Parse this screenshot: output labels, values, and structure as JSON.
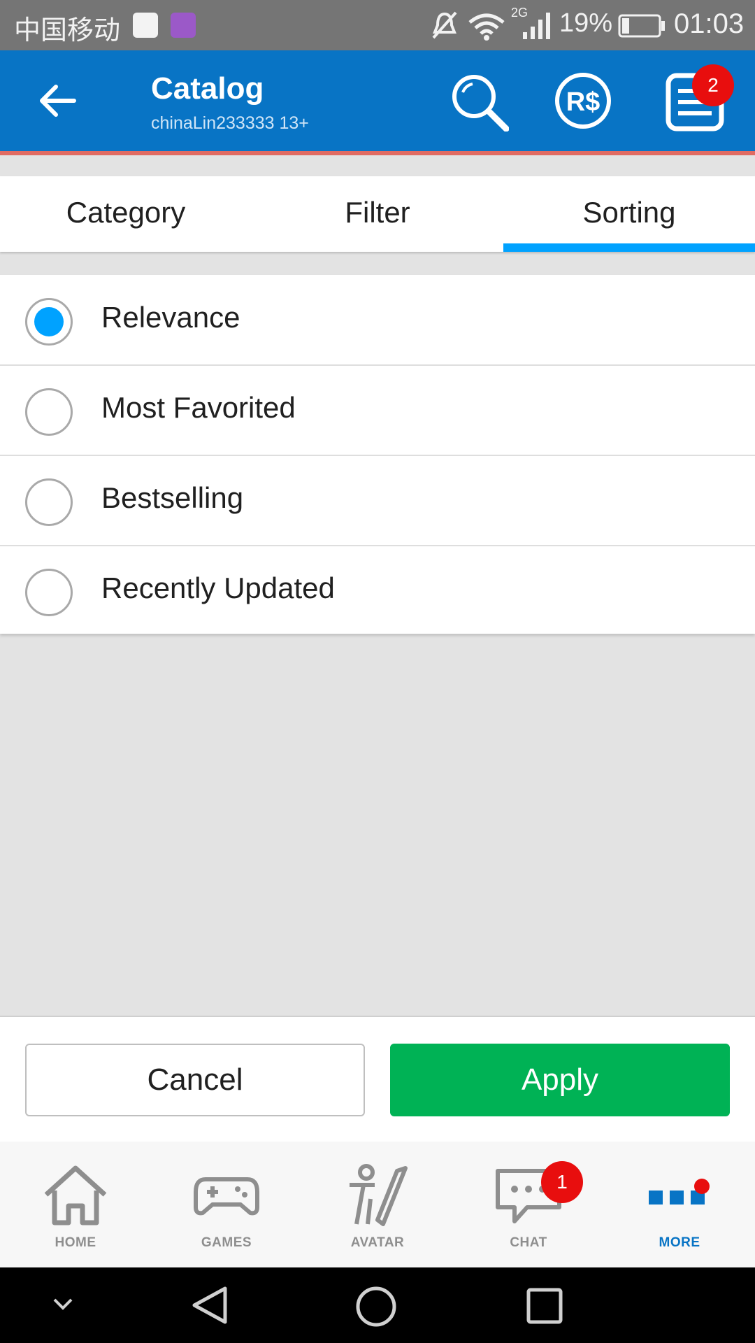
{
  "status_bar": {
    "carrier": "中国移动",
    "network": "2G",
    "battery": "19%",
    "time": "01:03"
  },
  "header": {
    "title": "Catalog",
    "subtitle": "chinaLin233333 13+",
    "notification_count": "2"
  },
  "tabs": [
    {
      "label": "Category"
    },
    {
      "label": "Filter"
    },
    {
      "label": "Sorting",
      "active": true
    }
  ],
  "sort_options": [
    {
      "label": "Relevance",
      "selected": true
    },
    {
      "label": "Most Favorited",
      "selected": false
    },
    {
      "label": "Bestselling",
      "selected": false
    },
    {
      "label": "Recently Updated",
      "selected": false
    }
  ],
  "actions": {
    "cancel_label": "Cancel",
    "apply_label": "Apply"
  },
  "bottom_nav": [
    {
      "label": "HOME",
      "icon": "home-icon"
    },
    {
      "label": "GAMES",
      "icon": "gamepad-icon"
    },
    {
      "label": "AVATAR",
      "icon": "avatar-icon"
    },
    {
      "label": "CHAT",
      "icon": "chat-icon",
      "badge": "1"
    },
    {
      "label": "MORE",
      "icon": "more-icon",
      "active": true
    }
  ],
  "colors": {
    "header_blue": "#0874c5",
    "accent_blue": "#00a2ff",
    "apply_green": "#00b255",
    "badge_red": "#e80e0e"
  }
}
